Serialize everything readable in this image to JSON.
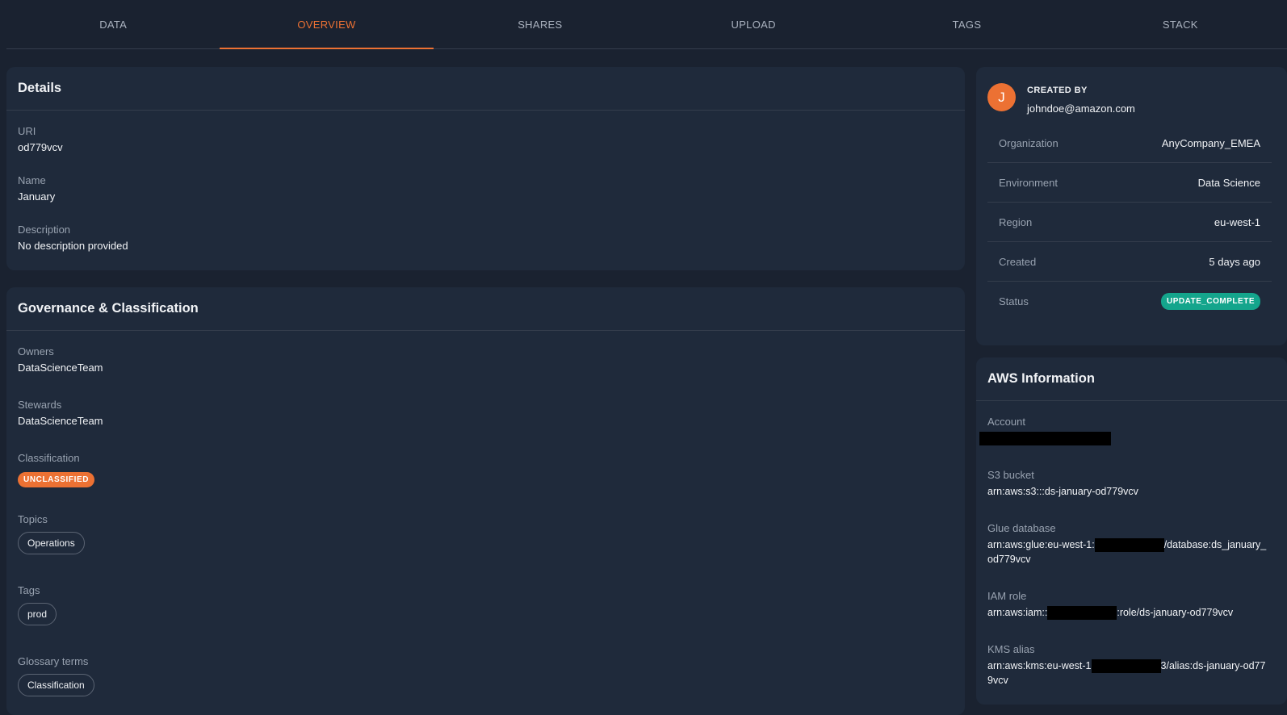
{
  "tabs": [
    {
      "label": "DATA",
      "active": false
    },
    {
      "label": "OVERVIEW",
      "active": true
    },
    {
      "label": "SHARES",
      "active": false
    },
    {
      "label": "UPLOAD",
      "active": false
    },
    {
      "label": "TAGS",
      "active": false
    },
    {
      "label": "STACK",
      "active": false
    }
  ],
  "details": {
    "title": "Details",
    "uri": {
      "label": "URI",
      "value": "od779vcv"
    },
    "name": {
      "label": "Name",
      "value": "January"
    },
    "description": {
      "label": "Description",
      "value": "No description provided"
    }
  },
  "governance": {
    "title": "Governance & Classification",
    "owners": {
      "label": "Owners",
      "value": "DataScienceTeam"
    },
    "stewards": {
      "label": "Stewards",
      "value": "DataScienceTeam"
    },
    "classification": {
      "label": "Classification",
      "value": "UNCLASSIFIED"
    },
    "topics": {
      "label": "Topics",
      "value": "Operations"
    },
    "tags": {
      "label": "Tags",
      "value": "prod"
    },
    "glossary": {
      "label": "Glossary terms",
      "value": "Classification"
    }
  },
  "creator": {
    "initial": "J",
    "label": "CREATED BY",
    "email": "johndoe@amazon.com"
  },
  "meta": {
    "organization": {
      "label": "Organization",
      "value": "AnyCompany_EMEA"
    },
    "environment": {
      "label": "Environment",
      "value": "Data Science"
    },
    "region": {
      "label": "Region",
      "value": "eu-west-1"
    },
    "created": {
      "label": "Created",
      "value": "5 days ago"
    },
    "status": {
      "label": "Status",
      "value": "UPDATE_COMPLETE"
    }
  },
  "aws": {
    "title": "AWS Information",
    "account": {
      "label": "Account"
    },
    "s3": {
      "label": "S3 bucket",
      "value": "arn:aws:s3:::ds-january-od779vcv"
    },
    "glue": {
      "label": "Glue database",
      "prefix": "arn:aws:glue:eu-west-1:",
      "suffix": "/database:ds_january_od779vcv"
    },
    "iam": {
      "label": "IAM role",
      "prefix": "arn:aws:iam::",
      "suffix": ":role/ds-january-od779vcv"
    },
    "kms": {
      "label": "KMS alias",
      "prefix": "arn:aws:kms:eu-west-1",
      "suffix": "3/alias:ds-january-od779vcv"
    }
  },
  "colors": {
    "accent": "#ec7133",
    "status_ok": "#14a58c",
    "background": "#1a2230",
    "card": "#1f2a3b"
  }
}
